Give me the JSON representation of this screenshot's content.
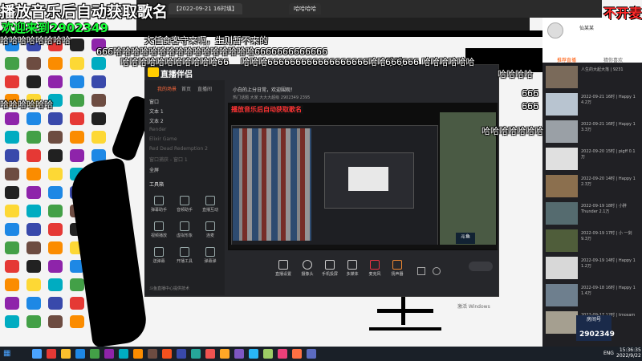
{
  "overlay": {
    "title": "播放音乐后自动获取歌名",
    "subtitle": "欢迎来到2902349",
    "right_text": "不开麦"
  },
  "danmaku": [
    {
      "text": "哈哈哈哈哈哈哈哈",
      "cls": "d1"
    },
    {
      "text": "大任食客守来啊，生则暂不来的",
      "cls": "d2"
    },
    {
      "text": "666哈哈哈哈哈哈哈哈哈哈哈哈哈哈哈哈6666666666666",
      "cls": "d3"
    },
    {
      "text": "哈哈哈哈哈哈哈哈哈哈哈66",
      "cls": "d4"
    },
    {
      "text": "哈哈哈666666666666666666哈哈哈哈",
      "cls": "d5"
    },
    {
      "text": "666666 哈哈哈哈哈哈",
      "cls": "d6"
    },
    {
      "text": "哈哈哈哈",
      "cls": "d7"
    },
    {
      "text": "666",
      "cls": "d8"
    },
    {
      "text": "哈哈哈哈哈哈哈",
      "cls": "d9"
    },
    {
      "text": "666",
      "cls": "d10"
    },
    {
      "text": "哈哈哈哈哈哈",
      "cls": "d11"
    }
  ],
  "browser": {
    "tab1": "【2022-09-21 16时填】",
    "tab2": "哈哈哈哈"
  },
  "app": {
    "title": "直播伴侣",
    "side_tabs": [
      "我的场景",
      "首页",
      "直播间"
    ],
    "sources": [
      "窗口",
      "文本 1",
      "文本 2",
      "Render",
      "Elixir Game",
      "Red Dead Redemption 2",
      "窗口捕获 - 窗口 1",
      "全屏"
    ],
    "tools_label": "工具箱",
    "tools": [
      "弹幕助手",
      "音频助手",
      "直播互动",
      "视频播放",
      "虚拟形象",
      "连麦",
      "送弹幕",
      "开播工具",
      "弹幕弹"
    ],
    "preview_label": "播放音乐后自动获取歌名",
    "room_title": "小白的上分日常，欢迎围观！",
    "stats": "热门话题 大家  大大大超级  2902349  2395",
    "bottom_tools": [
      "直播设置",
      "摄像头",
      "手机投屏",
      "多媒体",
      "麦克风",
      "扬声器"
    ],
    "footer": "斗鱼直播中心提供技术"
  },
  "right_panel": {
    "user": "仙某某",
    "tab1": "推荐直播",
    "tab2": "猜你喜欢",
    "items": [
      "人生的大起大落 | 9231",
      "2022-09-21 16时 | Happy 1 4.2万",
      "2022-09-21 16时 | Happy 1 3.3万",
      "2022-09-20 15时 | pigff 0.1万",
      "2022-09-20 14时 | Happy 1 2.3万",
      "2022-09-19 18时 | 小胖Thunder 2.1万",
      "2022-09-19 17时 | 小 一剑 9.3万",
      "2022-09-19 14时 | Happy 1 1.2万",
      "2022-09-18 16时 | Happy 1 1.4万",
      "2022-09-17 12时 | tmosam 2.6万"
    ],
    "watermark": "房间号",
    "room_number": "2902349"
  },
  "taskbar": {
    "time": "15:36:35",
    "date": "2022/9/22",
    "lang": "ENG"
  },
  "activate_text": "激活 Windows"
}
